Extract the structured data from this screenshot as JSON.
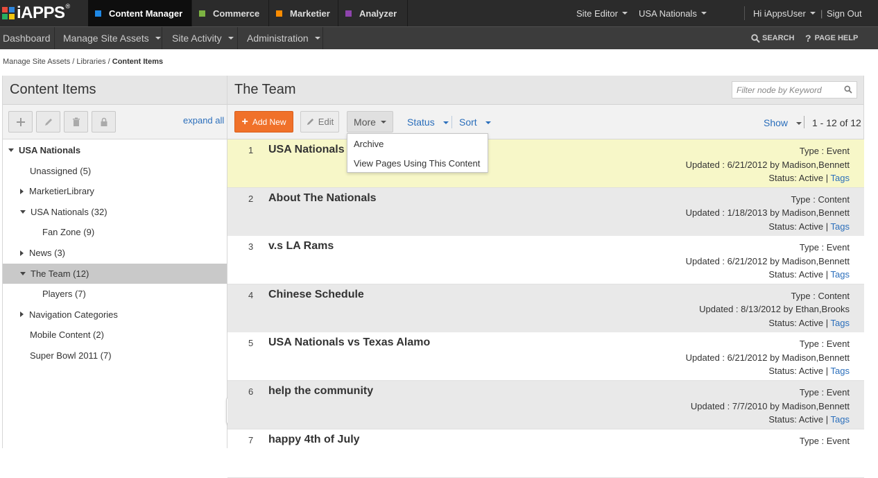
{
  "logo": {
    "text": "iAPPS",
    "reg": "®",
    "colors": [
      "#e74c3c",
      "#2e86de",
      "#27ae60",
      "#f1c40f"
    ]
  },
  "apps": [
    {
      "label": "Content Manager",
      "color": "#1e88e5",
      "active": true
    },
    {
      "label": "Commerce",
      "color": "#7cb342",
      "active": false
    },
    {
      "label": "Marketier",
      "color": "#fb8c00",
      "active": false
    },
    {
      "label": "Analyzer",
      "color": "#8e44ad",
      "active": false
    }
  ],
  "topright": {
    "site_editor": "Site Editor",
    "site": "USA Nationals",
    "user": "Hi iAppsUser",
    "signout": "Sign Out"
  },
  "nav": {
    "items": [
      "Dashboard",
      "Manage Site Assets",
      "Site Activity",
      "Administration"
    ],
    "search": "SEARCH",
    "help": "PAGE HELP"
  },
  "breadcrumb": {
    "part1": "Manage Site Assets /",
    "part2": "Libraries /",
    "current": "Content Items"
  },
  "left": {
    "title": "Content Items",
    "expand_all": "expand all",
    "tree": [
      {
        "label": "USA Nationals",
        "bold": true,
        "toggle": "down",
        "indent": 0
      },
      {
        "label": "Unassigned (5)",
        "toggle": "none",
        "indent": 1
      },
      {
        "label": "MarketierLibrary",
        "toggle": "right",
        "indent": 1
      },
      {
        "label": "USA Nationals (32)",
        "toggle": "down",
        "indent": 1
      },
      {
        "label": "Fan Zone (9)",
        "toggle": "none",
        "indent": 2
      },
      {
        "label": "News (3)",
        "toggle": "right",
        "indent": 1
      },
      {
        "label": "The Team (12)",
        "toggle": "down",
        "indent": 1,
        "selected": true
      },
      {
        "label": "Players (7)",
        "toggle": "none",
        "indent": 2
      },
      {
        "label": "Navigation Categories",
        "toggle": "right",
        "indent": 1
      },
      {
        "label": "Mobile Content (2)",
        "toggle": "none",
        "indent": 1
      },
      {
        "label": "Super Bowl 2011 (7)",
        "toggle": "none",
        "indent": 1
      }
    ]
  },
  "right": {
    "title": "The Team",
    "filter_placeholder": "Filter node by Keyword",
    "add_new": "Add New",
    "edit": "Edit",
    "more": "More",
    "status": "Status",
    "sort": "Sort",
    "show": "Show",
    "count": "1 - 12 of 12",
    "more_menu": [
      "Archive",
      "View Pages Using This Content"
    ],
    "rows": [
      {
        "num": "1",
        "title": "USA Nationals",
        "type": "Type : Event",
        "updated": "Updated : 6/21/2012 by Madison,Bennett",
        "status": "Status: Active |",
        "tags": "Tags",
        "style": "hl"
      },
      {
        "num": "2",
        "title": "About The Nationals",
        "type": "Type : Content",
        "updated": "Updated : 1/18/2013 by Madison,Bennett",
        "status": "Status: Active |",
        "tags": "Tags",
        "style": "gray"
      },
      {
        "num": "3",
        "title": "v.s LA Rams",
        "type": "Type : Event",
        "updated": "Updated : 6/21/2012 by Madison,Bennett",
        "status": "Status: Active |",
        "tags": "Tags",
        "style": "white"
      },
      {
        "num": "4",
        "title": "Chinese Schedule",
        "type": "Type : Content",
        "updated": "Updated : 8/13/2012 by Ethan,Brooks",
        "status": "Status: Active |",
        "tags": "Tags",
        "style": "gray"
      },
      {
        "num": "5",
        "title": "USA Nationals vs Texas Alamo",
        "type": "Type : Event",
        "updated": "Updated : 6/21/2012 by Madison,Bennett",
        "status": "Status: Active |",
        "tags": "Tags",
        "style": "white"
      },
      {
        "num": "6",
        "title": "help the community",
        "type": "Type : Event",
        "updated": "Updated : 7/7/2010 by Madison,Bennett",
        "status": "Status: Active |",
        "tags": "Tags",
        "style": "gray"
      },
      {
        "num": "7",
        "title": "happy 4th of July",
        "type": "Type : Event",
        "updated": "",
        "status": "",
        "tags": "",
        "style": "white"
      }
    ]
  }
}
